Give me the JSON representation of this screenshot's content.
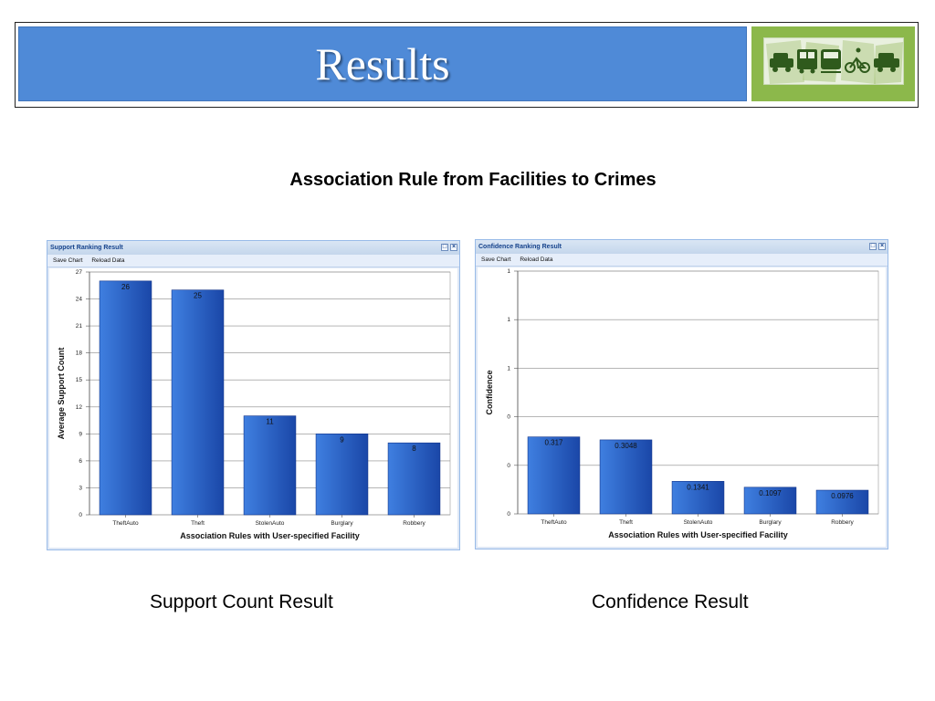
{
  "slide": {
    "title": "Results",
    "subtitle": "Association Rule from Facilities to Crimes",
    "caption_left": "Support Count Result",
    "caption_right": "Confidence Result",
    "logo_icons": [
      "car-icon",
      "bus-icon",
      "train-icon",
      "bicycle-icon",
      "car-icon"
    ]
  },
  "colors": {
    "banner": "#4f8ad7",
    "logo_bg": "#8cb84b",
    "bar_light": "#3f7fe0",
    "bar_dark": "#1a47a8",
    "window_border": "#99bbe8"
  },
  "windows": {
    "support": {
      "title": "Support Ranking Result",
      "save_label": "Save Chart",
      "reload_label": "Reload Data"
    },
    "confidence": {
      "title": "Confidence Ranking Result",
      "save_label": "Save Chart",
      "reload_label": "Reload Data"
    }
  },
  "chart_data": [
    {
      "type": "bar",
      "categories": [
        "TheftAuto",
        "Theft",
        "StolenAuto",
        "Burglary",
        "Robbery"
      ],
      "values": [
        26,
        25,
        11,
        9,
        8
      ],
      "value_labels": [
        "26",
        "25",
        "11",
        "9",
        "8"
      ],
      "xlabel": "Association Rules with User-specified Facility",
      "ylabel": "Average Support Count",
      "ylim": [
        0,
        27
      ],
      "yticks": [
        0,
        3,
        6,
        9,
        12,
        15,
        18,
        21,
        24,
        27
      ],
      "ytick_labels": [
        "0",
        "3",
        "6",
        "9",
        "12",
        "15",
        "18",
        "21",
        "24",
        "27"
      ],
      "grid": true
    },
    {
      "type": "bar",
      "categories": [
        "TheftAuto",
        "Theft",
        "StolenAuto",
        "Burglary",
        "Robbery"
      ],
      "values": [
        0.317,
        0.3048,
        0.1341,
        0.1097,
        0.0976
      ],
      "value_labels": [
        "0.317",
        "0.3048",
        "0.1341",
        "0.1097",
        "0.0976"
      ],
      "xlabel": "Association Rules with User-specified Facility",
      "ylabel": "Confidence",
      "ylim": [
        0,
        1
      ],
      "yticks": [
        0,
        0.2,
        0.4,
        0.6,
        0.8,
        1
      ],
      "ytick_labels": [
        "0",
        "0",
        "0",
        "1",
        "1",
        "1"
      ],
      "grid": true
    }
  ]
}
